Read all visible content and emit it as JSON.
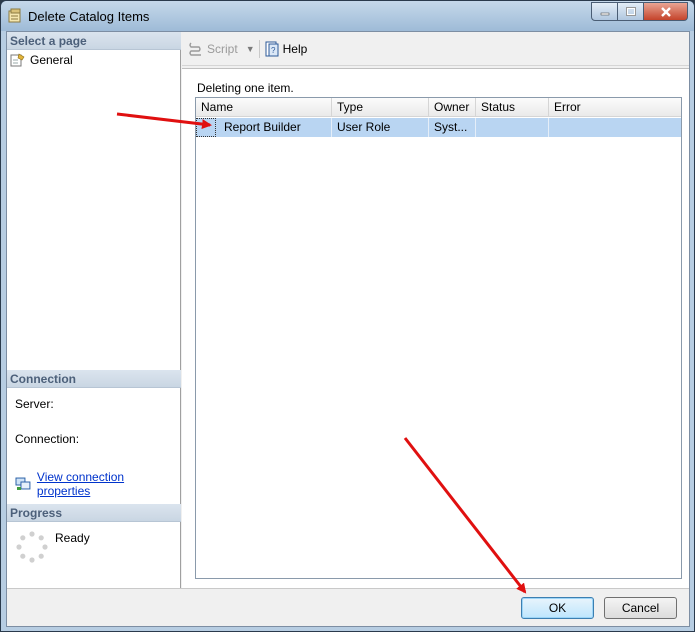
{
  "window": {
    "title": "Delete Catalog Items",
    "controls": [
      "minimize",
      "maximize",
      "close"
    ]
  },
  "left_pane": {
    "select_page_header": "Select a page",
    "pages": [
      {
        "label": "General",
        "icon": "page-wrench-icon"
      }
    ],
    "connection_header": "Connection",
    "server_label": "Server:",
    "connection_label": "Connection:",
    "view_connection_link": "View connection properties",
    "progress_header": "Progress",
    "progress_status": "Ready"
  },
  "toolbar": {
    "script_label": "Script",
    "help_label": "Help"
  },
  "main": {
    "status_text": "Deleting one item.",
    "columns": [
      "Name",
      "Type",
      "Owner",
      "Status",
      "Error"
    ],
    "rows": [
      {
        "name": "Report Builder",
        "type": "User Role",
        "owner": "Syst...",
        "status": "",
        "error": ""
      }
    ]
  },
  "buttons": {
    "ok": "OK",
    "cancel": "Cancel"
  },
  "colors": {
    "selection": "#b9d5f2",
    "section_header_text": "#4c607a",
    "link": "#0033cc",
    "annotation_arrow": "#e01010"
  }
}
